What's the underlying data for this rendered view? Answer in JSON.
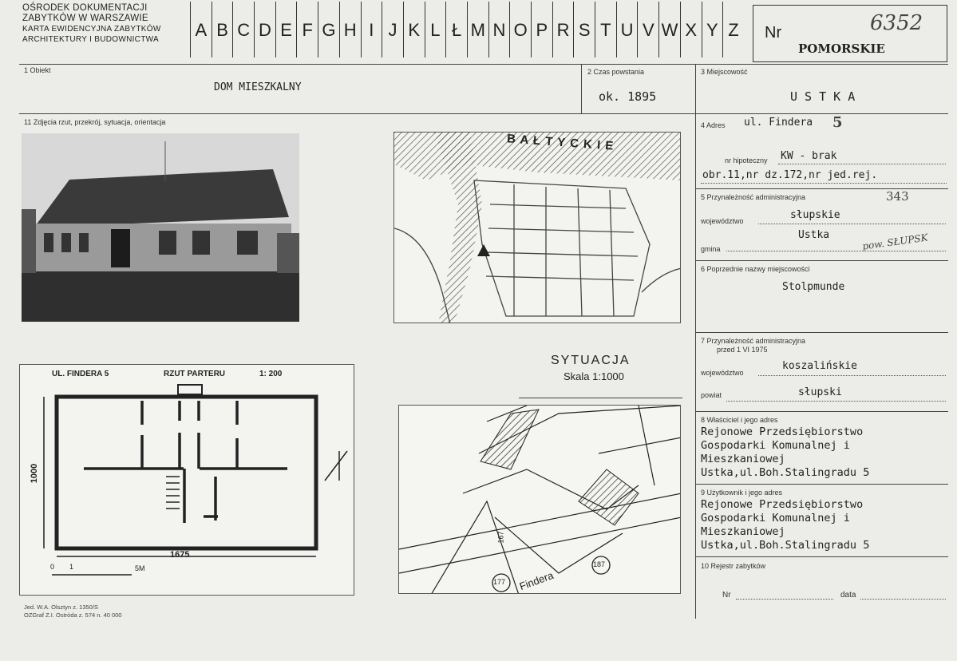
{
  "header": {
    "institution_lines": [
      "OŚRODEK DOKUMENTACJI",
      "ZABYTKÓW W WARSZAWIE",
      "KARTA EWIDENCYJNA ZABYTKÓW",
      "ARCHITEKTURY I BUDOWNICTWA"
    ],
    "letters": [
      "A",
      "B",
      "C",
      "D",
      "E",
      "F",
      "G",
      "H",
      "I",
      "J",
      "K",
      "L",
      "Ł",
      "M",
      "N",
      "O",
      "P",
      "R",
      "S",
      "T",
      "U",
      "V",
      "W",
      "X",
      "Y",
      "Z"
    ],
    "nr_label": "Nr",
    "nr_value": "6352",
    "region": "POMORSKIE"
  },
  "fields": {
    "obiekt_label": "1 Obiekt",
    "obiekt_value": "DOM MIESZKALNY",
    "czas_label": "2 Czas powstania",
    "czas_value": "ok. 1895",
    "miejscowosc_label": "3 Miejscowość",
    "miejscowosc_value": "U S T K A",
    "zdjecia_label": "11 Zdjęcia rzut, przekrój, sytuacja, orientacja",
    "adres_label": "4 Adres",
    "adres_value": "ul. Findera",
    "adres_number": "5",
    "hipoteczny_label": "nr hipoteczny",
    "hipoteczny_value": "KW - brak",
    "dzialka_value": "obr.11,nr dz.172,nr jed.rej.",
    "jed_rej_hand": "343",
    "przynaleznosc_label": "5 Przynależność administracyjna",
    "woj_label": "województwo",
    "woj_value": "słupskie",
    "gmina_label": "gmina",
    "gmina_value": "Ustka",
    "gmina_hand": "pow. SŁUPSK",
    "poprzednie_label": "6 Poprzednie nazwy miejscowości",
    "poprzednie_value": "Stolpmunde",
    "przyn1975_label_1": "7 Przynależność administracyjna",
    "przyn1975_label_2": "przed 1 VI 1975",
    "woj1975_label": "województwo",
    "woj1975_value": "koszalińskie",
    "powiat_label": "powiat",
    "powiat_value": "słupski",
    "wlasciciel_label": "8 Właściciel i jego adres",
    "wlasciciel_lines": [
      "Rejonowe Przedsiębiorstwo",
      "Gospodarki Komunalnej i",
      "Mieszkaniowej",
      "Ustka,ul.Boh.Stalingradu 5"
    ],
    "uzytkownik_label": "9 Użytkownik i jego adres",
    "uzytkownik_lines": [
      "Rejonowe Przedsiębiorstwo",
      "Gospodarki Komunalnej i",
      "Mieszkaniowej",
      "Ustka,ul.Boh.Stalingradu 5"
    ],
    "rejestr_label": "10 Rejestr zabytków",
    "rejestr_nr_label": "Nr",
    "rejestr_data_label": "data"
  },
  "map": {
    "sea_label": "B A Ł T Y C K I E",
    "situation_title": "SYTUACJA",
    "situation_scale": "Skala 1:1000"
  },
  "floorplan": {
    "address": "UL. FINDERA 5",
    "title": "RZUT PARTERU",
    "scale": "1: 200",
    "width_dim": "1675",
    "depth_dim": "1000",
    "scalebar_start": "0",
    "scalebar_1": "1",
    "scalebar_end": "5M"
  },
  "cadastre": {
    "street": "Findera",
    "plot_numbers": [
      "177",
      "187",
      "167"
    ]
  },
  "footer": {
    "line1": "Jed. W.A. Olsztyn z. 1350/S",
    "line2": "OZGraf Z.I. Ostróda z. 574 n. 40 000"
  }
}
